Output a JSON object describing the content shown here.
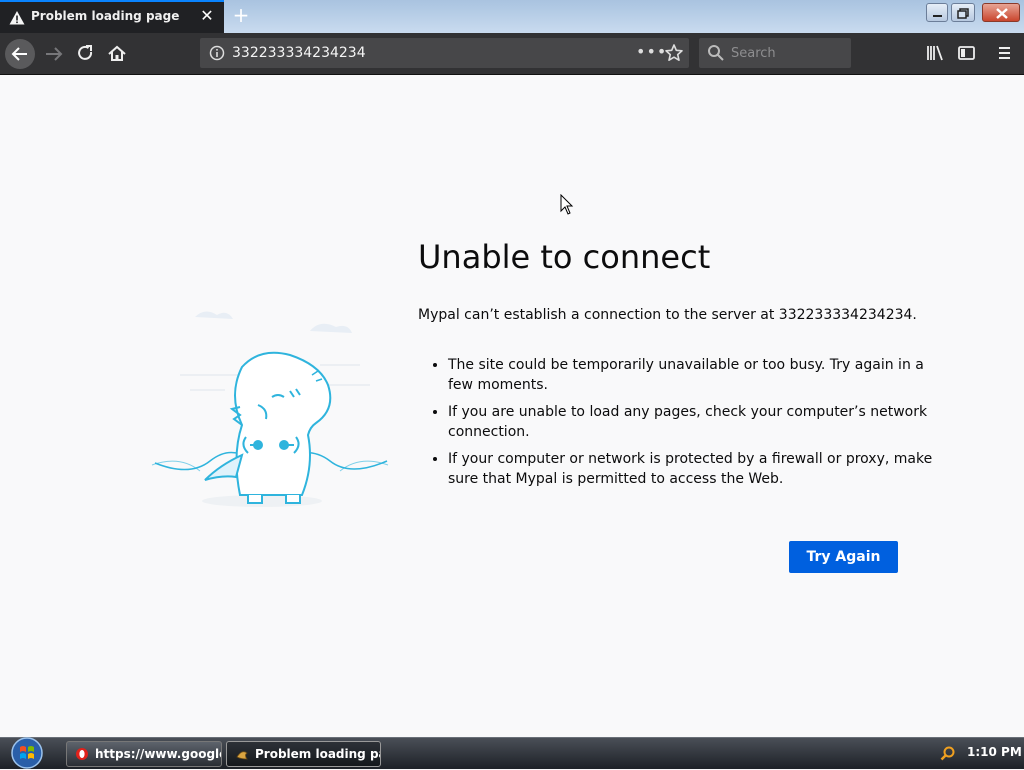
{
  "tab": {
    "title": "Problem loading page"
  },
  "navbar": {
    "url": "332233334234234",
    "page_actions": "•••",
    "search_placeholder": "Search"
  },
  "error": {
    "title": "Unable to connect",
    "description": "Mypal can’t establish a connection to the server at 332233334234234.",
    "items": [
      "The site could be temporarily unavailable or too busy. Try again in a few moments.",
      "If you are unable to load any pages, check your computer’s network connection.",
      "If your computer or network is protected by a firewall or proxy, make sure that Mypal is permitted to access the Web."
    ],
    "button": "Try Again"
  },
  "taskbar": {
    "items": [
      {
        "label": "https://www.google...."
      },
      {
        "label": "Problem loading pag..."
      }
    ],
    "clock": "1:10 PM"
  },
  "colors": {
    "accent": "#0060df",
    "toolbar": "#323234",
    "tab_active": "#202124",
    "illustration": "#2fb4dd"
  }
}
